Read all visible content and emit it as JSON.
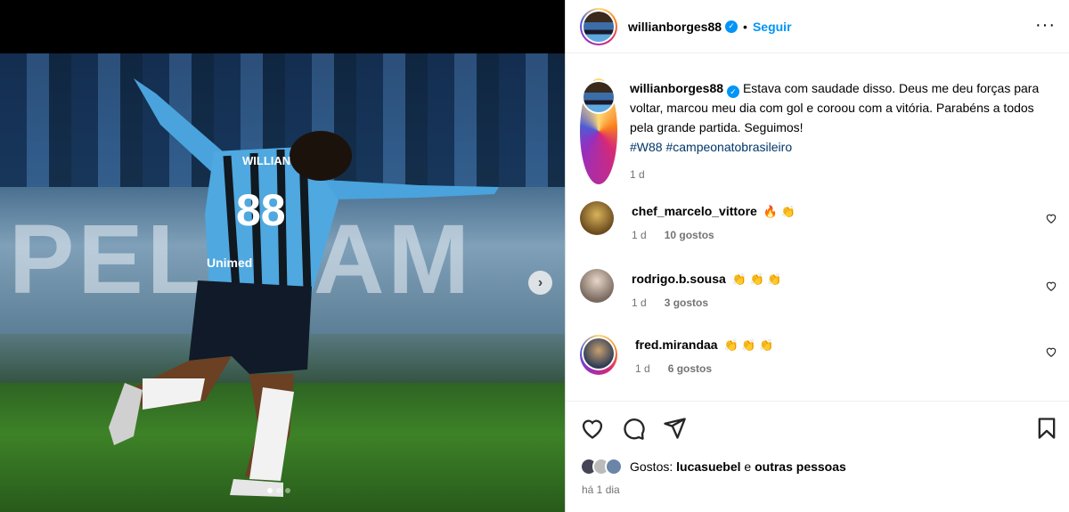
{
  "post": {
    "username": "willianborges88",
    "verified_glyph": "✓",
    "dot": "•",
    "follow_label": "Seguir",
    "more_label": "···",
    "caption": "Estava com saudade disso. Deus me deu forças para voltar, marcou meu dia com gol e coroou com a vitória. Parabéns a todos pela grande partida. Seguimos!",
    "hashtags": [
      "#W88",
      "#campeonatobrasileiro"
    ],
    "caption_time": "1 d",
    "media": {
      "banner_text": "PEL  CAM",
      "jersey_name": "WILLIAN",
      "jersey_number": "88",
      "sponsor": "Unimed",
      "next_glyph": "›"
    }
  },
  "comments": [
    {
      "username": "chef_marcelo_vittore",
      "text": "🔥 👏",
      "time": "1 d",
      "likes": "10 gostos"
    },
    {
      "username": "rodrigo.b.sousa",
      "text": "👏 👏 👏",
      "time": "1 d",
      "likes": "3 gostos"
    },
    {
      "username": "fred.mirandaa",
      "text": "👏 👏 👏",
      "time": "1 d",
      "likes": "6 gostos"
    }
  ],
  "likes": {
    "prefix": "Gostos:",
    "user": "lucasuebel",
    "joiner": "e",
    "others": "outras pessoas"
  },
  "posted_ago": "há 1 dia",
  "icons": [
    "heart-icon",
    "comment-icon",
    "share-icon",
    "bookmark-icon",
    "more-icon",
    "chevron-right-icon",
    "verified-icon"
  ],
  "colors": {
    "accent": "#0095f6",
    "hashtag": "#00376b",
    "muted": "#737373"
  }
}
